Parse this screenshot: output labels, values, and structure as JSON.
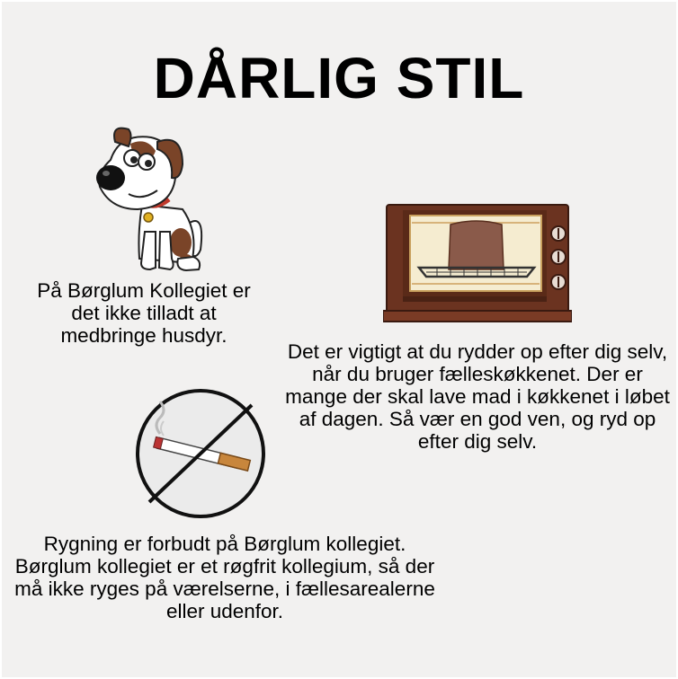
{
  "title": "DÅRLIG STIL",
  "rules": [
    {
      "icon": "dog-icon",
      "text": "På Børglum Kollegiet er det ikke tilladt at medbringe husdyr."
    },
    {
      "icon": "oven-icon",
      "text": "Det er vigtigt at du rydder op efter dig selv, når du bruger fælleskøkkenet. Der er mange der skal lave mad i køkkenet i løbet af dagen. Så vær en god ven, og ryd op efter dig selv."
    },
    {
      "icon": "no-smoking-icon",
      "text": "Rygning er forbudt på Børglum kollegiet. Børglum kollegiet er et røgfrit kollegium, så der må ikke ryges på værelserne, i fællesarealerne eller udenfor."
    }
  ]
}
